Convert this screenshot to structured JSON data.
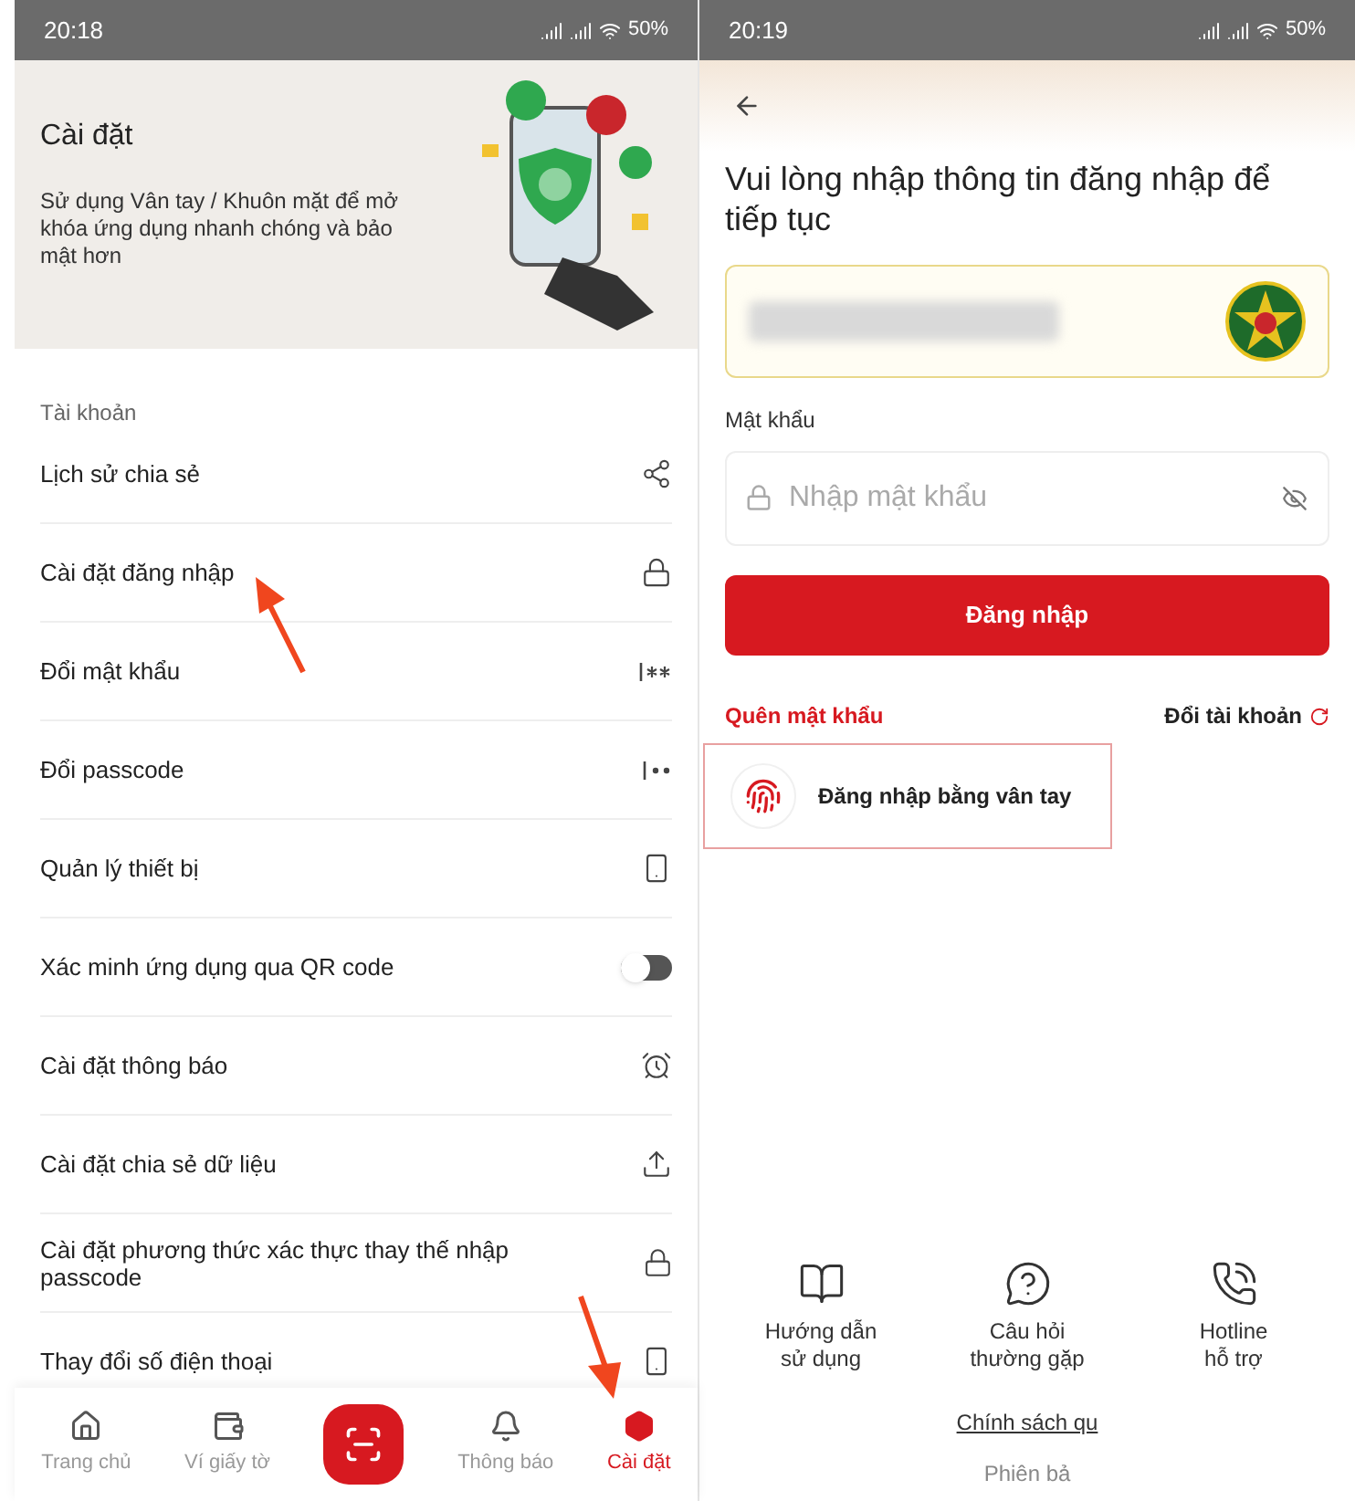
{
  "left_screen": {
    "status_bar": {
      "time": "20:18",
      "battery": "50%"
    },
    "header": {
      "title": "Cài đặt",
      "description": "Sử dụng Vân tay / Khuôn mặt để mở  khóa ứng dụng nhanh chóng và bảo mật hơn"
    },
    "section_title": "Tài khoản",
    "settings_items": [
      {
        "label": "Lịch sử chia sẻ",
        "kind": "link"
      },
      {
        "label": "Cài đặt đăng nhập",
        "kind": "link"
      },
      {
        "label": "Đổi mật khẩu",
        "kind": "link"
      },
      {
        "label": "Đổi passcode",
        "kind": "link"
      },
      {
        "label": "Quản lý thiết bị",
        "kind": "link"
      },
      {
        "label": "Xác minh ứng dụng qua QR code",
        "kind": "toggle",
        "on": false
      },
      {
        "label": "Cài đặt thông báo",
        "kind": "link"
      },
      {
        "label": "Cài đặt chia sẻ dữ liệu",
        "kind": "link"
      },
      {
        "label": "Cài đặt phương thức xác thực thay thế nhập passcode",
        "kind": "link"
      },
      {
        "label": "Thay đổi số điện thoại",
        "kind": "link"
      }
    ],
    "bottom_nav": [
      {
        "kind": "tab",
        "label": "Trang chủ",
        "selected": false
      },
      {
        "kind": "tab",
        "label": "Ví giấy tờ",
        "selected": false
      },
      {
        "kind": "scan"
      },
      {
        "kind": "tab",
        "label": "Thông báo",
        "selected": false
      },
      {
        "kind": "tab",
        "label": "Cài đặt",
        "selected": true
      }
    ]
  },
  "right_screen": {
    "status_bar": {
      "time": "20:19",
      "battery": "50%"
    },
    "title": "Vui lòng nhập thông tin đăng nhập để tiếp tục",
    "password_label": "Mật khẩu",
    "password_field": {
      "placeholder": "Nhập mật khẩu"
    },
    "login_button": "Đăng nhập",
    "forgot_password": "Quên mật khẩu",
    "switch_account": "Đổi tài khoản",
    "fingerprint_login": "Đăng nhập bằng vân tay",
    "help_items": [
      "Hướng dẫn\nsử dụng",
      "Câu hỏi\nthường gặp",
      "Hotline\nhỗ trợ"
    ],
    "privacy_link": "Chính sách qu",
    "version": "Phiên bả"
  }
}
